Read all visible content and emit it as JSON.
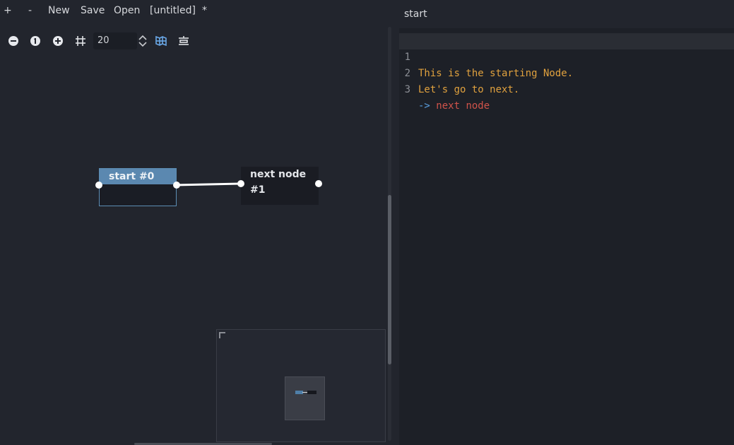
{
  "menubar": {
    "plus_label": "+",
    "minus_label": "-",
    "new_label": "New",
    "save_label": "Save",
    "open_label": "Open",
    "file_name": "[untitled]",
    "modified_marker": "*"
  },
  "toolbar": {
    "zoom_out_icon": "zoom-out-icon",
    "zoom_reset_icon": "zoom-reset-icon",
    "zoom_in_icon": "zoom-in-icon",
    "snap_grid_icon": "grid-snap-icon",
    "snap_distance": "20",
    "minimap_toggle_icon": "minimap-icon",
    "arrange_icon": "arrange-nodes-icon"
  },
  "graph": {
    "nodes": [
      {
        "title": "start #0",
        "selected": true
      },
      {
        "title": "next node #1",
        "selected": false
      }
    ]
  },
  "editor": {
    "title": "start",
    "lines": [
      {
        "num": "1",
        "text": "This is the starting Node."
      },
      {
        "num": "2",
        "text": "Let's go to next."
      },
      {
        "num": "3",
        "arrow": "->",
        "target": "next node"
      }
    ]
  },
  "colors": {
    "accent": "#5b88b0",
    "text_orange": "#e0a13e",
    "arrow_blue": "#5a9fe0",
    "target_red": "#d0534a"
  }
}
